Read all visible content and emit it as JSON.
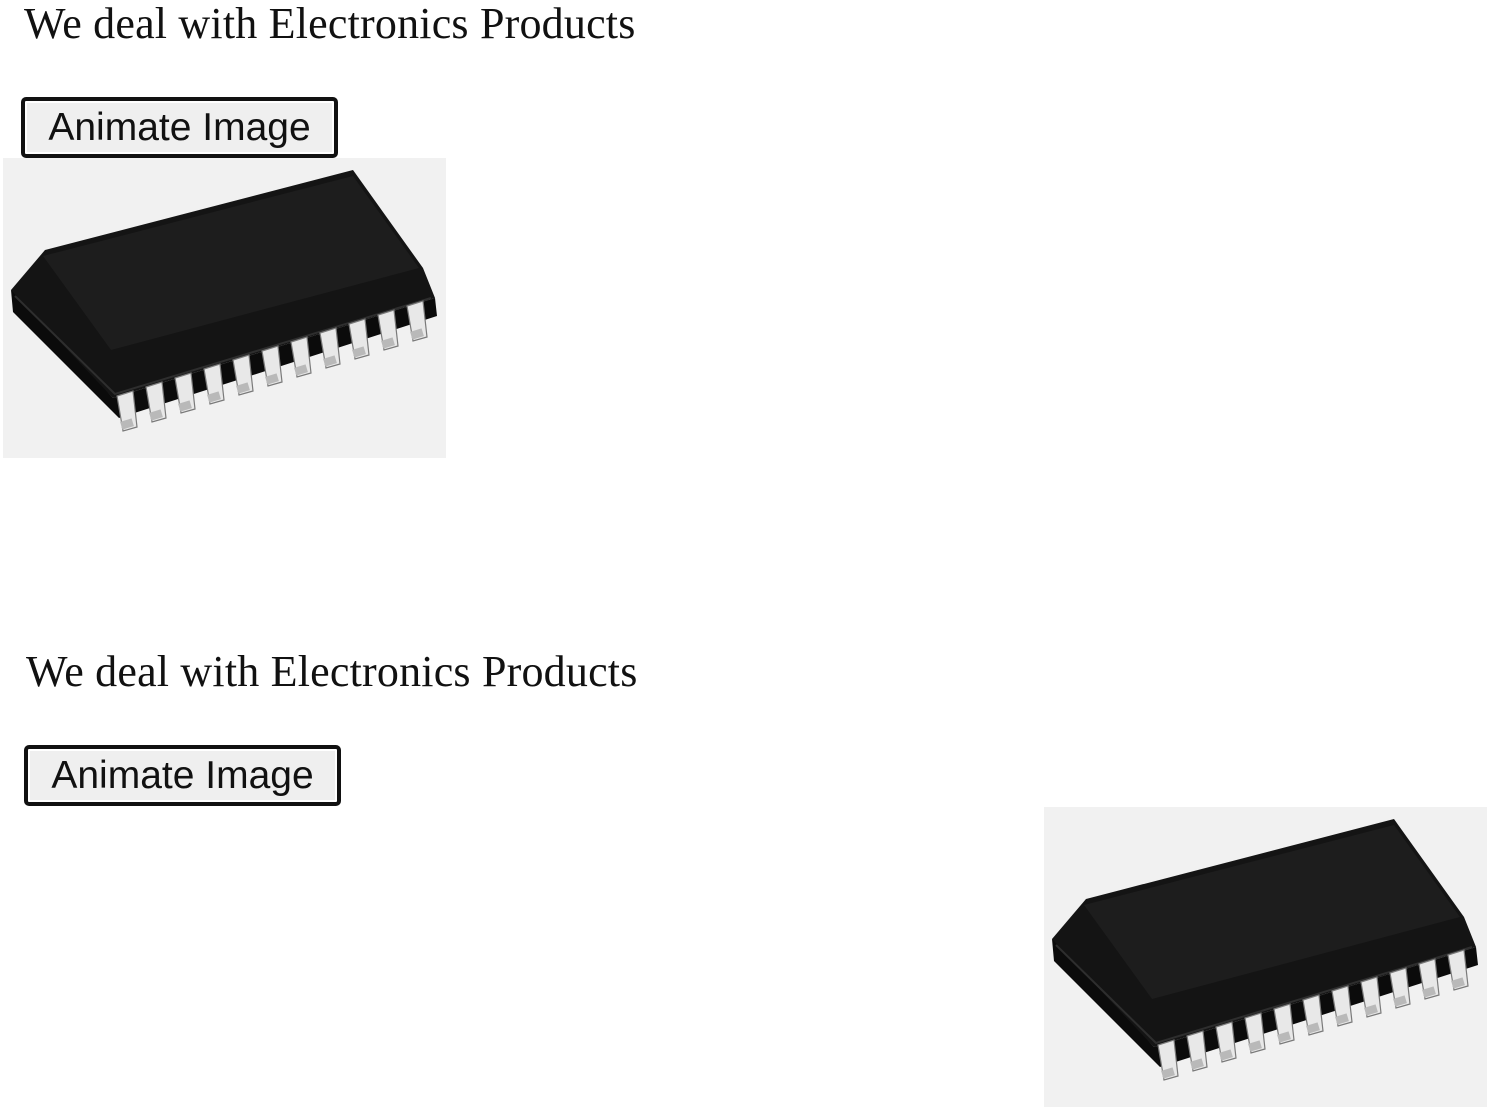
{
  "demo_before": {
    "heading": "We deal with Electronics Products",
    "button_label": "Animate Image",
    "image_icon": "ic-chip-icon"
  },
  "demo_after": {
    "heading": "We deal with Electronics Products",
    "button_label": "Animate Image",
    "image_icon": "ic-chip-icon"
  },
  "colors": {
    "page_background": "#ffffff",
    "text": "#111111",
    "button_face": "#efefef",
    "button_border": "#111111",
    "image_background": "#f1f1f1",
    "chip_body": "#141414",
    "chip_pins": "#e6e6e6"
  }
}
